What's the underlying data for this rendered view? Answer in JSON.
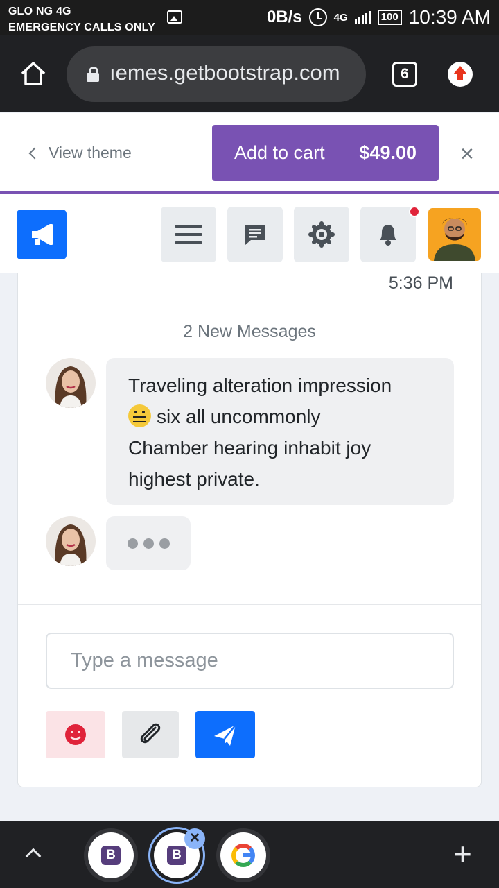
{
  "status_bar": {
    "carrier": "GLO NG 4G",
    "emergency": "EMERGENCY CALLS ONLY",
    "speed": "0B/s",
    "network": "4G",
    "battery": "100",
    "time": "10:39 AM"
  },
  "browser": {
    "url": "ıemes.getbootstrap.com",
    "tab_count": "6"
  },
  "theme_bar": {
    "view_theme": "View theme",
    "add_to_cart": "Add to cart",
    "price": "$49.00",
    "close": "×"
  },
  "chat": {
    "last_time": "5:36 PM",
    "new_messages": "2 New Messages",
    "message": {
      "line1": "Traveling alteration impression",
      "line2": "six all uncommonly",
      "line3": "Chamber hearing inhabit joy",
      "line4": "highest private."
    },
    "input_placeholder": "Type a message"
  },
  "bottom_bar": {
    "tab1_logo": "B",
    "tab2_logo": "B",
    "close": "×",
    "plus": "+"
  },
  "colors": {
    "brand": "#7952b3",
    "primary": "#0d6efd",
    "danger": "#e0233a"
  }
}
